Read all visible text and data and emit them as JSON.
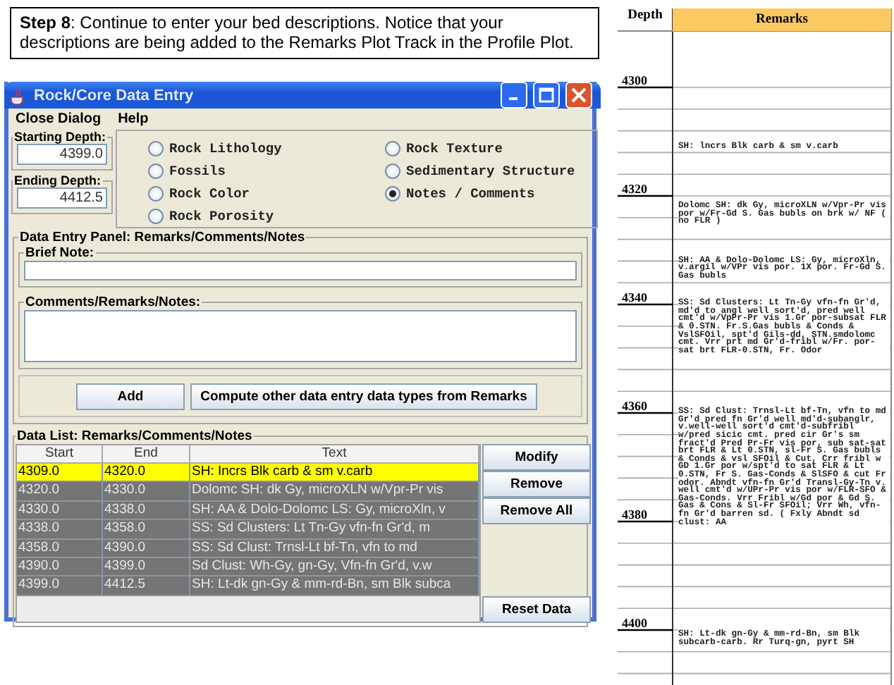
{
  "instruction": {
    "text": "**Step 8**: Continue to enter your bed descriptions.  Notice that your descriptions are being added to the Remarks Plot Track in the Profile Plot."
  },
  "window": {
    "title": "Rock/Core Data Entry",
    "menu": [
      "Close Dialog",
      "Help"
    ],
    "starting_depth": {
      "label": "Starting Depth:",
      "value": "4399.0"
    },
    "ending_depth": {
      "label": "Ending Depth:",
      "value": "4412.5"
    },
    "data_types": [
      {
        "label": "Rock Lithology",
        "selected": false
      },
      {
        "label": "Fossils",
        "selected": false
      },
      {
        "label": "Rock Color",
        "selected": false
      },
      {
        "label": "Rock Porosity",
        "selected": false
      },
      {
        "label": "Rock Texture",
        "selected": false
      },
      {
        "label": "Sedimentary Structure",
        "selected": false
      },
      {
        "label": "Notes / Comments",
        "selected": true
      }
    ],
    "entry_panel": {
      "title": "Data Entry Panel: Remarks/Comments/Notes",
      "brief_note": {
        "label": "Brief Note:"
      },
      "comments": {
        "label": "Comments/Remarks/Notes:"
      },
      "buttons": [
        "Add",
        "Compute other data entry data types from Remarks"
      ]
    },
    "data_list": {
      "title": "Data List: Remarks/Comments/Notes",
      "columns": [
        "Start",
        "End",
        "Text"
      ],
      "rows": [
        {
          "start": "4309.0",
          "end": "4320.0",
          "text": "SH: Incrs Blk carb & sm v.carb",
          "selected": true
        },
        {
          "start": "4320.0",
          "end": "4330.0",
          "text": "Dolomc SH: dk Gy, microXLN w/Vpr-Pr vis",
          "selected": false
        },
        {
          "start": "4330.0",
          "end": "4338.0",
          "text": "SH: AA & Dolo-Dolomc LS: Gy, microXln, v",
          "selected": false
        },
        {
          "start": "4338.0",
          "end": "4358.0",
          "text": "SS: Sd Clusters: Lt Tn-Gy vfn-fn Gr'd, m",
          "selected": false
        },
        {
          "start": "4358.0",
          "end": "4390.0",
          "text": "SS: Sd Clust: Trnsl-Lt bf-Tn, vfn to md",
          "selected": false
        },
        {
          "start": "4390.0",
          "end": "4399.0",
          "text": "Sd Clust: Wh-Gy, gn-Gy, Vfn-fn Gr'd, v.w",
          "selected": false
        },
        {
          "start": "4399.0",
          "end": "4412.5",
          "text": "SH: Lt-dk gn-Gy & mm-rd-Bn, sm Blk subca",
          "selected": false
        }
      ],
      "buttons": [
        "Modify",
        "Remove",
        "Remove All"
      ],
      "reset_button": "Reset Data"
    }
  },
  "profile_plot": {
    "columns": [
      "Depth",
      "Remarks"
    ],
    "depth_labels": [
      "4300",
      "4320",
      "4340",
      "4360",
      "4380",
      "4400"
    ],
    "remarks": [
      {
        "text": "SH: lncrs Blk carb & sm v.carb"
      },
      {
        "text": "Dolomc SH: dk Gy, microXLN w/Vpr-Pr vis por w/Fr-Gd S. Gas bubls on brk w/ NF ( no FLR )"
      },
      {
        "text": "SH: AA & Dolo-Dolomc LS: Gy, microXln, v.argil w/VPr vis por. 1X por. Fr-Gd S. Gas bubls"
      },
      {
        "text": "SS: Sd Clusters: Lt Tn-Gy vfn-fn Gr'd, md'd to angl well sort'd, pred well cmt'd w/VpPr-Pr vis 1.Gr por-subsat FLR & 0.STN. Fr.S.Gas bubls & Conds & VslSFOil, spt'd Gils-dd, STN.smdolomc cmt. Vrr prt md Gr'd-fribl w/Fr. por-sat brt FLR-0.STN, Fr. Odor"
      },
      {
        "text": "SS: Sd Clust: Trnsl-Lt bf-Tn, vfn to md Gr'd pred fn Gr'd well md'd-subanglr, v.well-well sort'd cmt'd-subfribl w/pred sicic cmt. pred cir Gr's sm fract'd Pred Pr-Fr vis por, sub sat-sat brt FLR & Lt 0.STN, sl-Fr S. Gas bubls & Conds & vsl SFOil & Cut, Crr fribl w GD 1.Gr por w/spt'd to sat FLR & Lt 0.STN, Fr S. Gas-Conds & SlSFO & cut Fr odor. Abndt vfn-fn Gr'd Transl-Gy-Tn v. well cmt'd w/UPr-Pr vis por w/FLR-SFO & Gas-Conds. Vrr Fribl w/Gd por & Gd S. Gas & Cons & Sl-Fr SFOil; Vrr Wh, vfn-fn Gr'd barren sd. ( Fxly Abndt sd clust: AA"
      },
      {
        "text": "SH: Lt-dk gn-Gy & mm-rd-Bn, sm Blk subcarb-carb. Rr Turq-gn, pyrt SH"
      }
    ]
  }
}
